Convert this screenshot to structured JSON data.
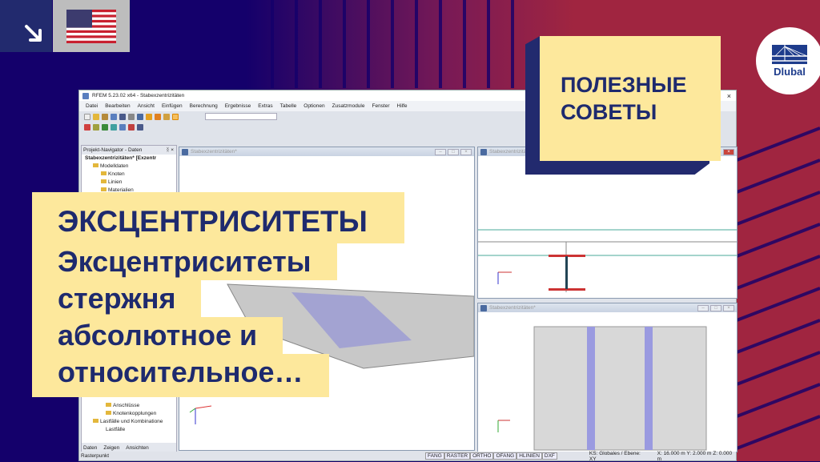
{
  "window": {
    "title": "RFEM 5.23.02 x64 - Stabexzentrizitäten",
    "close": "×"
  },
  "menu": [
    "Datei",
    "Bearbeiten",
    "Ansicht",
    "Einfügen",
    "Berechnung",
    "Ergebnisse",
    "Extras",
    "Tabelle",
    "Optionen",
    "Zusatzmodule",
    "Fenster",
    "Hilfe"
  ],
  "navigator": {
    "title": "Projekt-Navigator - Daten",
    "pin": "ᛝ ×",
    "tree": [
      "Stabexzentrizitäten* [Exzentr",
      "Modelldaten",
      "Knoten",
      "Linien",
      "Materialien"
    ],
    "tree_bottom": [
      "Anschlüsse",
      "Knotenkopplungen",
      "Lastfälle und Kombinatione",
      "Lastfälle"
    ],
    "tabs": [
      "Daten",
      "Zeigen",
      "Ansichten"
    ]
  },
  "views": {
    "title": "Stabexzentrizitäten*"
  },
  "status": {
    "left": "Rasterpunkt",
    "toggles": [
      "FANG",
      "RASTER",
      "ORTHO",
      "OFANG",
      "HLINIEN",
      "DXF"
    ],
    "cs": "KS: Globales / Ebene: XY",
    "coords": "X: 16.000 m  Y: 2.000 m  Z: 0.000 m"
  },
  "overlay": {
    "heading": "ЭКСЦЕНТРИСИТЕТЫ",
    "lines": [
      "Эксцентриситеты",
      "стержня",
      "абсолютное и",
      "относительное…"
    ]
  },
  "tip": {
    "line1": "ПОЛЕЗНЫЕ",
    "line2": "СОВЕТЫ"
  },
  "logo": {
    "name": "Dlubal"
  },
  "colors": {
    "navy": "#14006b",
    "crimson": "#a02540",
    "yellow": "#fde89c",
    "text": "#1e2a6e"
  }
}
